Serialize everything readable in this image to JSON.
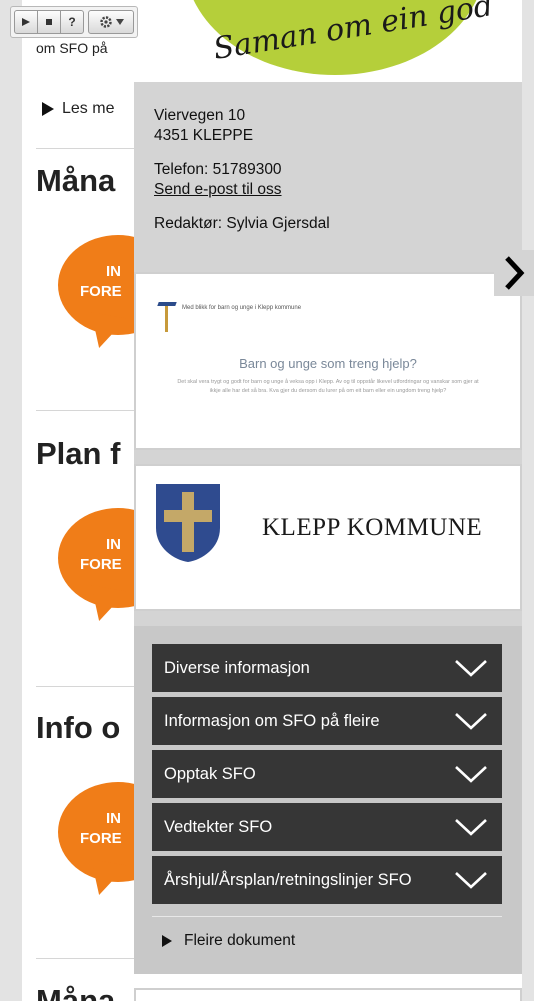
{
  "banner": {
    "text": "Saman om ein god"
  },
  "toolbar": {
    "play_icon": "play-icon",
    "stop_icon": "stop-icon",
    "help_label": "?",
    "settings_icon": "gear-icon",
    "dropdown_icon": "caret-down-icon"
  },
  "background": {
    "intro_snippet": "om SFO på",
    "read_more": "Les me",
    "sections": [
      {
        "title": "Måna"
      },
      {
        "title": "Plan f"
      },
      {
        "title": "Info o"
      },
      {
        "title": "Måna"
      }
    ],
    "badge": {
      "line1": "IN",
      "line2": "FORE"
    }
  },
  "contact": {
    "street": "Viervegen 10",
    "postal": "4351 KLEPPE",
    "phone": "Telefon: 51789300",
    "email_link": "Send e-post til oss",
    "editor": "Redaktør: Sylvia Gjersdal"
  },
  "promo_card": {
    "small_header": "Med blikk for barn og unge i Klepp kommune",
    "headline": "Barn og unge som treng hjelp?",
    "body": "Det skal vera trygt og godt for barn og unge å veksa opp i Klepp. Av og til oppstår likevel utfordringar og vanskar som gjer at ikkje alle har det så bra. Kva gjer du dersom du lurer på om eit barn eller ein ungdom treng hjelp?"
  },
  "municipality": {
    "name": "KLEPP KOMMUNE"
  },
  "documents": {
    "items": [
      {
        "label": "Diverse informasjon"
      },
      {
        "label": "Informasjon om SFO på fleire"
      },
      {
        "label": "Opptak SFO"
      },
      {
        "label": "Vedtekter SFO"
      },
      {
        "label": "Årshjul/Årsplan/retningslinjer SFO"
      }
    ],
    "more": "Fleire dokument"
  },
  "colors": {
    "overlay": "#d4d4d4",
    "accordion": "#363636",
    "badge": "#f07d18",
    "banner": "#b5cf3a"
  }
}
